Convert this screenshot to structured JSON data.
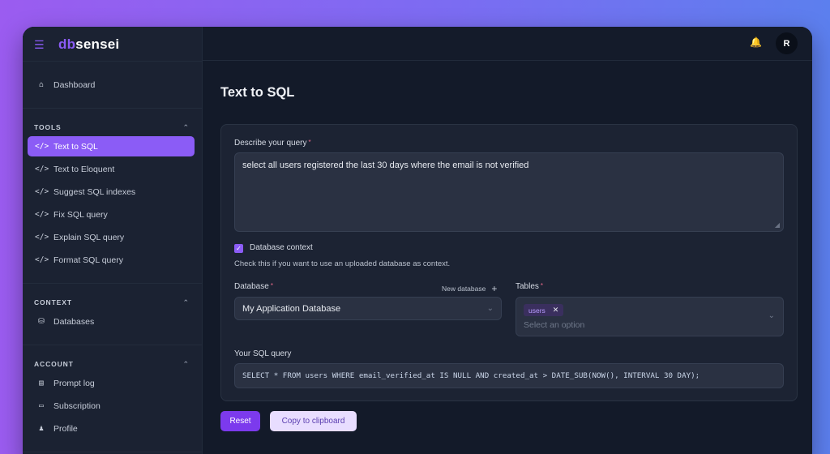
{
  "brand": {
    "logo_prefix": "db",
    "logo_suffix": "sensei"
  },
  "sidebar": {
    "dashboard": "Dashboard",
    "tools_title": "TOOLS",
    "tools": [
      {
        "label": "Text to SQL",
        "active": true
      },
      {
        "label": "Text to Eloquent"
      },
      {
        "label": "Suggest SQL indexes"
      },
      {
        "label": "Fix SQL query"
      },
      {
        "label": "Explain SQL query"
      },
      {
        "label": "Format SQL query"
      }
    ],
    "context_title": "CONTEXT",
    "context": [
      {
        "label": "Databases"
      }
    ],
    "account_title": "ACCOUNT",
    "account": [
      {
        "label": "Prompt log"
      },
      {
        "label": "Subscription"
      },
      {
        "label": "Profile"
      }
    ]
  },
  "header": {
    "avatar_initial": "R"
  },
  "main": {
    "title": "Text to SQL",
    "describe_label": "Describe your query",
    "describe_value": "select all users registered the last 30 days where the email is not verified",
    "db_context_label": "Database context",
    "db_context_checked": true,
    "db_context_hint": "Check this if you want to use an uploaded database as context.",
    "database_label": "Database",
    "new_database_label": "New database",
    "database_selected": "My Application Database",
    "tables_label": "Tables",
    "tables_selected": [
      "users"
    ],
    "tables_placeholder": "Select an option",
    "sql_label": "Your SQL query",
    "sql_value": "SELECT * FROM users WHERE email_verified_at IS NULL AND created_at > DATE_SUB(NOW(), INTERVAL 30 DAY);",
    "reset_label": "Reset",
    "copy_label": "Copy to clipboard"
  },
  "colors": {
    "accent": "#8b5cf6",
    "background": "#131a29",
    "sidebar": "#1b2232"
  }
}
